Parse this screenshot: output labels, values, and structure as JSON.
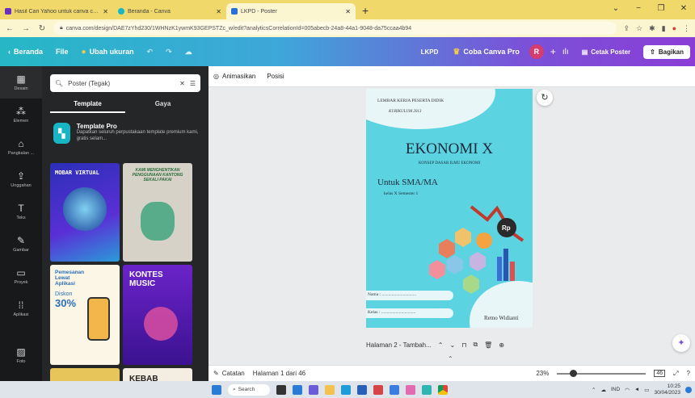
{
  "browser": {
    "tabs": [
      {
        "title": "Hasil Cari Yahoo untuk canva cd...",
        "color": "#6b2fbf"
      },
      {
        "title": "Beranda - Canva",
        "color": "#15b7c6"
      },
      {
        "title": "LKPD - Poster",
        "color": "#2a6fd6"
      }
    ],
    "url": "canva.com/design/DAE7zYhd230/1WHNzK1ywmK93GEPSTZc_w/edit?analyticsCorrelationId=005abecb-24a8-44a1-9048-da75ccaa4b94"
  },
  "canva_header": {
    "home": "Beranda",
    "file": "File",
    "resize": "Ubah ukuran",
    "design_name": "LKPD",
    "try_pro": "Coba Canva Pro",
    "avatar_initial": "R",
    "print": "Cetak Poster",
    "share": "Bagikan"
  },
  "rail": [
    {
      "icon": "layout-icon",
      "glyph": "▦",
      "label": "Desain"
    },
    {
      "icon": "elements-icon",
      "glyph": "⁂",
      "label": "Elemen"
    },
    {
      "icon": "brand-icon",
      "glyph": "⌂",
      "label": "Pangkalan ..."
    },
    {
      "icon": "upload-icon",
      "glyph": "⇪",
      "label": "Unggahan"
    },
    {
      "icon": "text-icon",
      "glyph": "T",
      "label": "Teks"
    },
    {
      "icon": "draw-icon",
      "glyph": "✎",
      "label": "Gambar"
    },
    {
      "icon": "folder-icon",
      "glyph": "▭",
      "label": "Proyek"
    },
    {
      "icon": "apps-icon",
      "glyph": "⁞⁞",
      "label": "Aplikasi"
    },
    {
      "icon": "photo-icon",
      "glyph": "▨",
      "label": "Foto"
    }
  ],
  "panel": {
    "search_placeholder": "Poster (Tegak)",
    "tabs": [
      "Template",
      "Gaya"
    ],
    "promo_title": "Template Pro",
    "promo_desc": "Dapatkan seluruh perpustakaan template premium kami, gratis selam...",
    "thumbs": [
      {
        "title": "MOBAR VIRTUAL"
      },
      {
        "title": "KAMI MENGHENTIKAN PENGGUNAAN KANTONG SEKALI PAKAI"
      },
      {
        "title": "Pemesanan Lewat Aplikasi",
        "sub": "Diskon",
        "big": "30%"
      },
      {
        "title": "KONTES MUSIC"
      },
      {
        "title": "KEBAB"
      }
    ]
  },
  "editor": {
    "animate": "Animasikan",
    "position": "Posisi",
    "page_label": "Halaman 2 - Tambah...",
    "notes": "Catatan",
    "page_count": "Halaman 1 dari 46",
    "zoom": "23%"
  },
  "poster": {
    "header1": "LEMBAR KERJA PESERTA DIDIK",
    "header2": "KURIKULUM 2013",
    "title": "EKONOMI X",
    "subtitle": "KONSEP DASAR ILMU EKONOMI",
    "for": "Untuk SMA/MA",
    "class": "kelas X Semester 1",
    "name_label": "Nama : ...............................",
    "kelas_label": "Kelas : ...............................",
    "author": "Retno Widianti",
    "rp": "Rp"
  },
  "taskbar": {
    "search": "Search",
    "lang": "IND",
    "time": "10:25",
    "date": "30/04/2023"
  }
}
